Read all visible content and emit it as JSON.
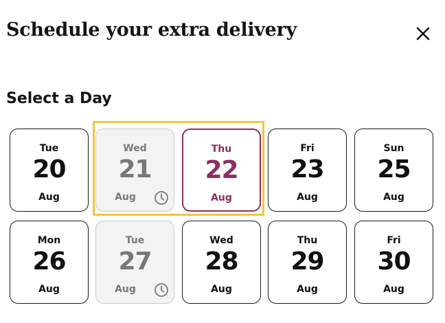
{
  "header": {
    "title": "Schedule your extra delivery",
    "close_icon": "close-icon"
  },
  "section": {
    "label": "Select a Day"
  },
  "days": [
    {
      "dow": "Tue",
      "date": "20",
      "month": "Aug",
      "state": "available"
    },
    {
      "dow": "Wed",
      "date": "21",
      "month": "Aug",
      "state": "unavailable",
      "icon": "clock-icon"
    },
    {
      "dow": "Thu",
      "date": "22",
      "month": "Aug",
      "state": "selected"
    },
    {
      "dow": "Fri",
      "date": "23",
      "month": "Aug",
      "state": "available"
    },
    {
      "dow": "Sun",
      "date": "25",
      "month": "Aug",
      "state": "available"
    },
    {
      "dow": "Mon",
      "date": "26",
      "month": "Aug",
      "state": "available"
    },
    {
      "dow": "Tue",
      "date": "27",
      "month": "Aug",
      "state": "unavailable",
      "icon": "clock-icon"
    },
    {
      "dow": "Wed",
      "date": "28",
      "month": "Aug",
      "state": "available"
    },
    {
      "dow": "Thu",
      "date": "29",
      "month": "Aug",
      "state": "available"
    },
    {
      "dow": "Fri",
      "date": "30",
      "month": "Aug",
      "state": "available"
    }
  ],
  "colors": {
    "selected_accent": "#8d2e5e",
    "highlight_outline": "#f2c640",
    "unavailable_bg": "#f3f3f3",
    "unavailable_text": "#787878"
  }
}
